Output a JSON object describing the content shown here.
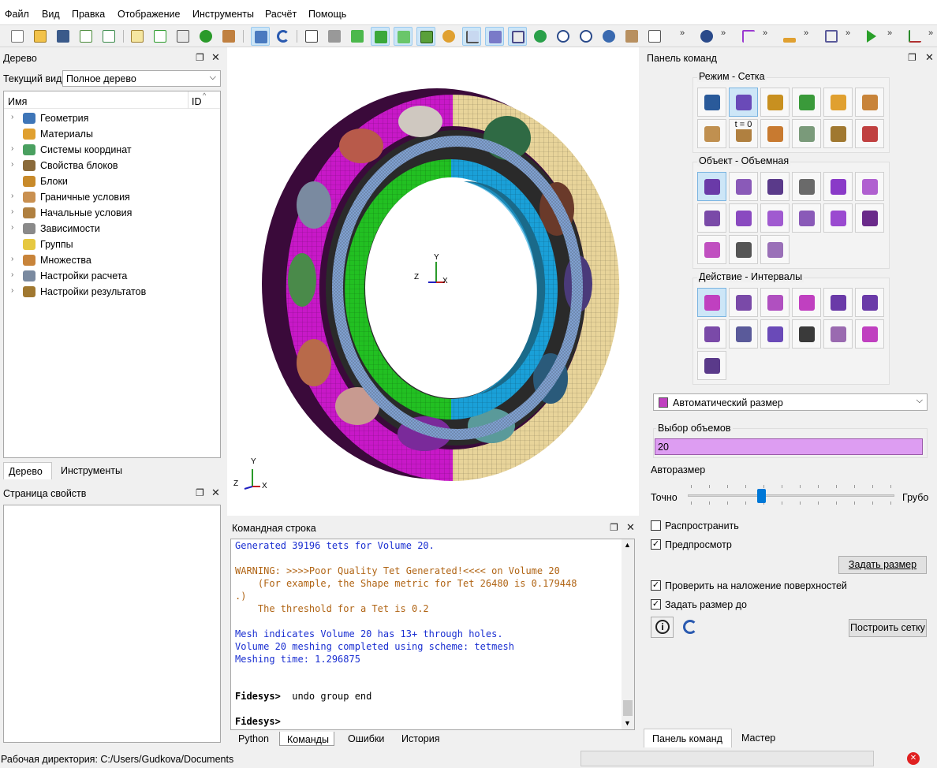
{
  "menu": [
    "Файл",
    "Вид",
    "Правка",
    "Отображение",
    "Инструменты",
    "Расчёт",
    "Помощь"
  ],
  "toolbar": {
    "overflow": "»"
  },
  "tree_panel": {
    "title": "Дерево",
    "view_label": "Текущий вид",
    "view_value": "Полное дерево",
    "col_name": "Имя",
    "col_id": "ID",
    "items": [
      {
        "label": "Геометрия",
        "icon": "geometry-icon",
        "color": "#3f76b8",
        "expand": "›"
      },
      {
        "label": "Материалы",
        "icon": "materials-icon",
        "color": "#e0a030",
        "expand": ""
      },
      {
        "label": "Системы координат",
        "icon": "coordinate-system-icon",
        "color": "#4aa060",
        "expand": "›"
      },
      {
        "label": "Свойства блоков",
        "icon": "block-properties-icon",
        "color": "#8a6a3a",
        "expand": "›"
      },
      {
        "label": "Блоки",
        "icon": "blocks-icon",
        "color": "#c88a2a",
        "expand": ""
      },
      {
        "label": "Граничные условия",
        "icon": "boundary-conditions-icon",
        "color": "#c99050",
        "expand": "›"
      },
      {
        "label": "Начальные условия",
        "icon": "initial-conditions-icon",
        "color": "#b08040",
        "expand": "›"
      },
      {
        "label": "Зависимости",
        "icon": "dependencies-icon",
        "color": "#8a8a8a",
        "expand": "›"
      },
      {
        "label": "Группы",
        "icon": "groups-icon",
        "color": "#e6c840",
        "expand": ""
      },
      {
        "label": "Множества",
        "icon": "sets-icon",
        "color": "#c8843a",
        "expand": "›"
      },
      {
        "label": "Настройки расчета",
        "icon": "calc-settings-icon",
        "color": "#7a8aa0",
        "expand": "›"
      },
      {
        "label": "Настройки результатов",
        "icon": "results-settings-icon",
        "color": "#a07830",
        "expand": "›"
      }
    ],
    "tabs": [
      "Дерево",
      "Инструменты"
    ]
  },
  "properties_panel": {
    "title": "Страница свойств"
  },
  "command_line": {
    "title": "Командная строка",
    "lines": [
      {
        "text": "Generated 39196 tets for Volume 20.",
        "color": "#1a2fd1"
      },
      {
        "text": "",
        "color": "#000"
      },
      {
        "text": "WARNING: >>>>Poor Quality Tet Generated!<<<< on Volume 20",
        "color": "#b06414"
      },
      {
        "text": "    (For example, the Shape metric for Tet 26480 is 0.179448",
        "color": "#b06414"
      },
      {
        "text": ".)",
        "color": "#b06414"
      },
      {
        "text": "    The threshold for a Tet is 0.2",
        "color": "#b06414"
      },
      {
        "text": "",
        "color": "#000"
      },
      {
        "text": "Mesh indicates Volume 20 has 13+ through holes.",
        "color": "#1a2fd1"
      },
      {
        "text": "Volume 20 meshing completed using scheme: tetmesh",
        "color": "#1a2fd1"
      },
      {
        "text": "Meshing time: 1.296875",
        "color": "#1a2fd1"
      },
      {
        "text": "",
        "color": "#000"
      },
      {
        "text": "",
        "color": "#000"
      },
      {
        "text": "",
        "color": "#000"
      }
    ],
    "prompt1": "Fidesys>",
    "cmd1": " undo group end",
    "prompt2": "Fidesys>",
    "tabs": [
      "Python",
      "Команды",
      "Ошибки",
      "История"
    ]
  },
  "command_panel": {
    "title": "Панель команд",
    "group1": "Режим - Сетка",
    "group2": "Объект - Объемная",
    "group3": "Действие - Интервалы",
    "mode_icons": [
      "geometry-mode-icon",
      "mesh-mode-icon",
      "material-mode-icon",
      "coord-system-mode-icon",
      "blocks-mode-icon",
      "sets-mode-icon",
      "boundary-mode-icon",
      "initial-mode-icon",
      "dependency-mode-icon",
      "calc-mode-icon",
      "results-mode-icon",
      "inspect-mode-icon"
    ],
    "initial_label": "t = 0",
    "object_icons": [
      "volume-icon",
      "surface-icon",
      "curve-icon",
      "node-icon",
      "group-icon",
      "hex-icon",
      "tet-icon",
      "quad-icon",
      "tri-icon",
      "edge-icon",
      "point-icon",
      "normal-icon",
      "assembly-icon",
      "grid-icon",
      "block-mesh-icon"
    ],
    "action_icons": [
      "interval-icon",
      "auto-size-icon",
      "match-icon",
      "smooth-icon",
      "copy-mesh-icon",
      "delete-mesh-icon",
      "refine-icon",
      "count-icon",
      "transfer-icon",
      "clean-icon",
      "quality-icon",
      "sweep-icon",
      "adjust-icon"
    ],
    "dropdown": "Автоматический размер",
    "select_label": "Выбор объемов",
    "select_value": "20",
    "autosize_label": "Авторазмер",
    "slider_left": "Точно",
    "slider_right": "Грубо",
    "slider_level": 0.35,
    "propagate": "Распространить",
    "preview": "Предпросмотр",
    "set_size": "Задать размер",
    "check_overlap": "Проверить на наложение поверхностей",
    "set_size_to": "Задать размер до",
    "build_mesh": "Построить сетку",
    "bottom_tabs": [
      "Панель команд",
      "Мастер"
    ]
  },
  "statusbar": {
    "path": "Рабочая директория: C:/Users/Gudkova/Documents"
  },
  "viewport": {
    "axis_x": "X",
    "axis_y": "Y",
    "axis_z": "Z"
  }
}
